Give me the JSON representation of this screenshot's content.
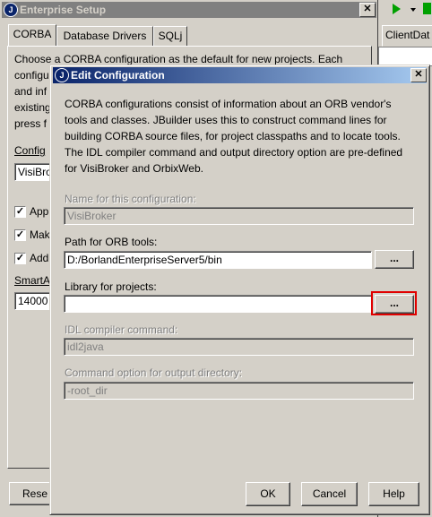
{
  "bg_window": {
    "title": "Enterprise Setup",
    "tabs": [
      "CORBA",
      "Database Drivers",
      "SQLj"
    ],
    "description_lines": [
      "Choose a CORBA configuration as the default for new projects.  Each",
      "configu",
      "and inf",
      "existing",
      "press f"
    ],
    "config_label": "Config",
    "config_value": "VisiBro",
    "checkboxes": [
      "App",
      "Mak",
      "Add"
    ],
    "smart_label": "SmartA",
    "smart_value": "14000",
    "reset_label": "Rese"
  },
  "bg_right": {
    "client_tab": "ClientDat"
  },
  "dialog": {
    "title": "Edit Configuration",
    "description": "CORBA configurations consist of information about an ORB vendor's tools and classes.  JBuilder uses this to construct command lines for building CORBA source files, for project classpaths and to locate tools. The IDL compiler command and output directory option are pre-defined for VisiBroker and OrbixWeb.",
    "name_label": "Name for this configuration:",
    "name_value": "VisiBroker",
    "path_label": "Path for ORB tools:",
    "path_value": "D:/BorlandEnterpriseServer5/bin",
    "browse_label": "...",
    "library_label": "Library for projects:",
    "library_value": "",
    "idl_label": "IDL compiler command:",
    "idl_value": "idl2java",
    "output_label": "Command option for output directory:",
    "output_value": "-root_dir",
    "ok": "OK",
    "cancel": "Cancel",
    "help": "Help"
  }
}
